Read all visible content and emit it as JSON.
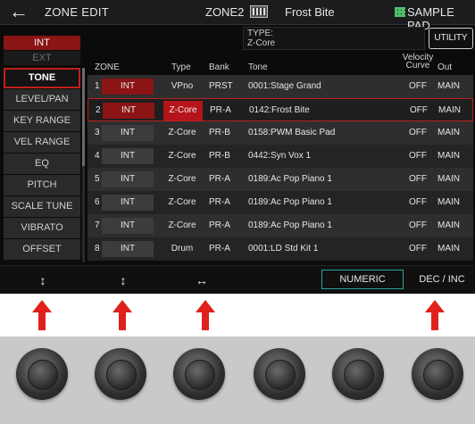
{
  "header": {
    "title": "ZONE EDIT",
    "zone": "ZONE2",
    "patch_name": "Frost Bite",
    "pad_label": "SAMPLE PAD"
  },
  "type_info": {
    "label": "TYPE:",
    "value": "Z-Core"
  },
  "utility_label": "UTILITY",
  "source": {
    "int_label": "INT",
    "ext_label": "EXT"
  },
  "menu": [
    {
      "label": "TONE",
      "active": true
    },
    {
      "label": "LEVEL/PAN"
    },
    {
      "label": "KEY RANGE"
    },
    {
      "label": "VEL RANGE"
    },
    {
      "label": "EQ"
    },
    {
      "label": "PITCH"
    },
    {
      "label": "SCALE TUNE"
    },
    {
      "label": "VIBRATO"
    },
    {
      "label": "OFFSET"
    }
  ],
  "table": {
    "headers": {
      "zone": "ZONE",
      "type": "Type",
      "bank": "Bank",
      "tone": "Tone",
      "velocity_line1": "Velocity",
      "velocity_line2": "Curve",
      "out": "Out"
    },
    "rows": [
      {
        "num": "1",
        "zone": "INT",
        "type": "VPno",
        "bank": "PRST",
        "tone": "0001:Stage Grand",
        "velocity": "OFF",
        "out": "MAIN"
      },
      {
        "num": "2",
        "zone": "INT",
        "type": "Z-Core",
        "bank": "PR-A",
        "tone": "0142:Frost Bite",
        "velocity": "OFF",
        "out": "MAIN"
      },
      {
        "num": "3",
        "zone": "INT",
        "type": "Z-Core",
        "bank": "PR-B",
        "tone": "0158:PWM Basic Pad",
        "velocity": "OFF",
        "out": "MAIN"
      },
      {
        "num": "4",
        "zone": "INT",
        "type": "Z-Core",
        "bank": "PR-B",
        "tone": "0442:Syn Vox 1",
        "velocity": "OFF",
        "out": "MAIN"
      },
      {
        "num": "5",
        "zone": "INT",
        "type": "Z-Core",
        "bank": "PR-A",
        "tone": "0189:Ac Pop Piano 1",
        "velocity": "OFF",
        "out": "MAIN"
      },
      {
        "num": "6",
        "zone": "INT",
        "type": "Z-Core",
        "bank": "PR-A",
        "tone": "0189:Ac Pop Piano 1",
        "velocity": "OFF",
        "out": "MAIN"
      },
      {
        "num": "7",
        "zone": "INT",
        "type": "Z-Core",
        "bank": "PR-A",
        "tone": "0189:Ac Pop Piano 1",
        "velocity": "OFF",
        "out": "MAIN"
      },
      {
        "num": "8",
        "zone": "INT",
        "type": "Drum",
        "bank": "PR-A",
        "tone": "0001:LD Std Kit 1",
        "velocity": "OFF",
        "out": "MAIN"
      }
    ]
  },
  "function_bar": {
    "knob1_glyph": "↕",
    "knob2_glyph": "↕",
    "knob3_glyph": "↔",
    "numeric_label": "NUMERIC",
    "decinc_label": "DEC / INC"
  },
  "icons": [
    "back-arrow-icon",
    "zone-keyboard-icon",
    "sample-pad-grid-icon",
    "vertical-arrows-icon",
    "horizontal-arrows-icon",
    "red-up-arrow-icon"
  ],
  "colors": {
    "accent_red": "#b5141b",
    "int_red": "#8b1414",
    "selection_border": "#c11f1f",
    "numeric_border": "#2e9f9f",
    "pad_green": "#53c66f",
    "arrow_red": "#e0211b"
  }
}
